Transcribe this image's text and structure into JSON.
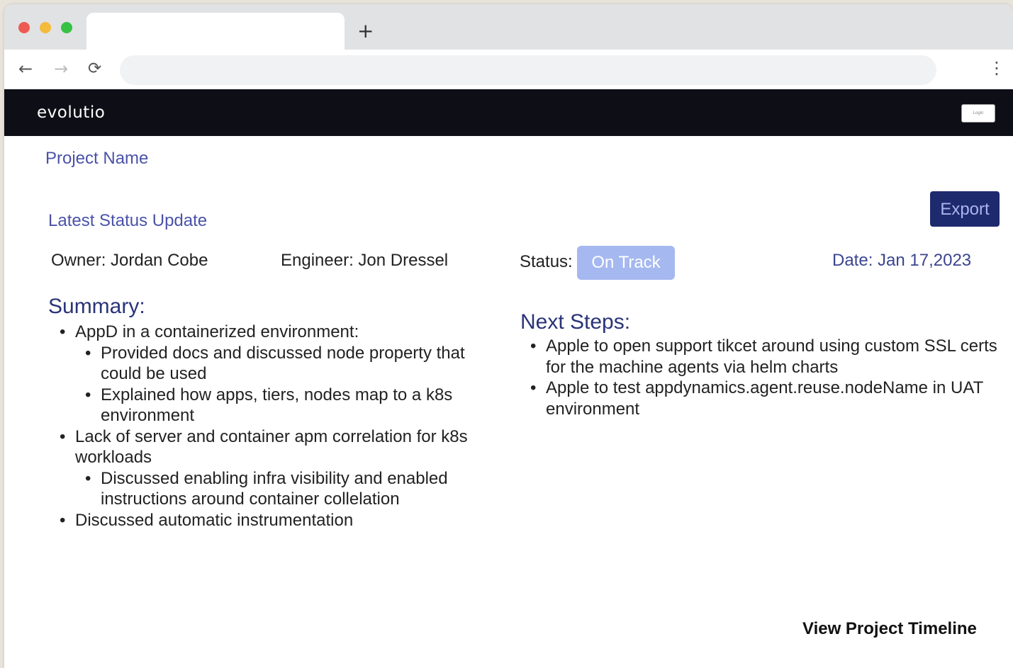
{
  "browser": {
    "new_tab_label": "+",
    "back_icon": "←",
    "forward_icon": "→",
    "reload_icon": "⟳",
    "menu_icon": "⋮",
    "colors": {
      "close": "#ee5b52",
      "minimize": "#f4bb3c",
      "maximize": "#37c246"
    }
  },
  "header": {
    "logo": "evolutio",
    "login_label": "Login"
  },
  "project": {
    "name": "Project Name",
    "export_label": "Export",
    "latest_heading": "Latest Status Update",
    "owner": "Owner: Jordan Cobe",
    "engineer": "Engineer: Jon Dressel",
    "status_label": "Status:",
    "status_value": "On Track",
    "date": "Date: Jan 17,2023"
  },
  "summary": {
    "title": "Summary:",
    "items": [
      {
        "text": "AppD in a containerized environment:",
        "children": [
          "Provided docs and discussed node property that could be used",
          "Explained how apps, tiers, nodes map to a k8s environment"
        ]
      },
      {
        "text": "Lack of server and container apm correlation for k8s workloads",
        "children": [
          "Discussed enabling infra visibility and enabled instructions around container collelation"
        ]
      },
      {
        "text": "Discussed automatic instrumentation",
        "children": []
      }
    ]
  },
  "next_steps": {
    "title": "Next Steps:",
    "items": [
      "Apple to open support tikcet around using custom SSL certs for the machine agents via helm charts",
      "Apple to test appdynamics.agent.reuse.nodeName in UAT environment"
    ]
  },
  "footer": {
    "timeline_link": "View Project Timeline"
  },
  "colors": {
    "navbar": "#0e0e17",
    "accent": "#4a52a8",
    "export_button": "#1e2a6e",
    "status_badge": "#a5b8f0"
  }
}
